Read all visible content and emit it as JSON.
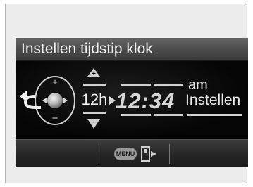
{
  "screen": {
    "title": "Instellen tijdstip klok",
    "clock_mode": "12h",
    "time": "12:34",
    "meridiem": "am",
    "set_label": "Instellen"
  },
  "footer": {
    "menu_label": "MENU"
  },
  "icons": {
    "back": "back-arrow-icon",
    "dial": "control-dial-icon",
    "up": "plus-up-arrow-icon",
    "down": "minus-down-arrow-icon",
    "right": "right-arrow-icon",
    "door": "exit-door-icon"
  },
  "colors": {
    "screen_bg": "#000000",
    "header_bg": "#4a4a4a",
    "text": "#e8e8e8",
    "highlight": "#d8d8d8"
  }
}
